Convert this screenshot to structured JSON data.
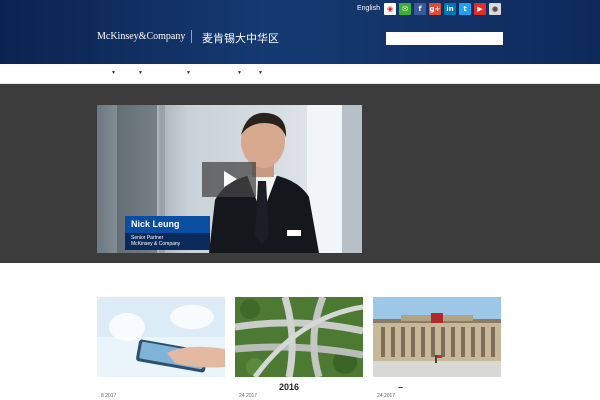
{
  "header": {
    "language_link": "English",
    "brand_name": "McKinsey&Company",
    "brand_name_cn": "麦肯锡大中华区",
    "search_placeholder": "",
    "social": [
      {
        "icon": "weibo-icon",
        "glyph": "微",
        "color": "#ffffff"
      },
      {
        "icon": "wechat-icon",
        "glyph": "微",
        "color": "#3cb034"
      },
      {
        "icon": "facebook-icon",
        "glyph": "f",
        "color": "#3b5998"
      },
      {
        "icon": "google-plus-icon",
        "glyph": "g+",
        "color": "#dd4b39"
      },
      {
        "icon": "linkedin-icon",
        "glyph": "in",
        "color": "#0077b5"
      },
      {
        "icon": "twitter-icon",
        "glyph": "t",
        "color": "#1da1f2"
      },
      {
        "icon": "youtube-icon",
        "glyph": "▶",
        "color": "#e52d27"
      },
      {
        "icon": "apple-icon",
        "glyph": "",
        "color": "#d9d9d9"
      }
    ]
  },
  "nav": {
    "items": [
      "",
      "",
      "",
      "",
      ""
    ]
  },
  "hero": {
    "person_name": "Nick Leung",
    "person_title": "Senior Partner",
    "person_company": "McKinsey & Company"
  },
  "cards": [
    {
      "date": "8 2017"
    },
    {
      "date": "24 2017"
    },
    {
      "date": "24 2017"
    }
  ],
  "section": {
    "year": "2016",
    "dash": "–"
  },
  "colors": {
    "header_dark": "#0b2350",
    "hero_bg": "#3c3c3c",
    "caption_blue": "#0a4ea2",
    "caption_navy": "#0b2a5c"
  }
}
